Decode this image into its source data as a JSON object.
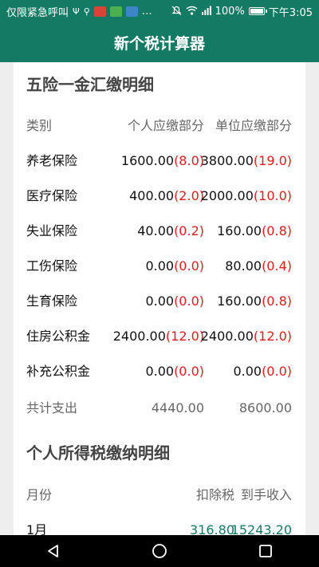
{
  "status": {
    "carrier": "仅限紧急呼叫",
    "battery": "100%",
    "battery_level": 1.0,
    "time": "下午3:05",
    "more": "…"
  },
  "app": {
    "title": "新个税计算器"
  },
  "insurance": {
    "title": "五险一金汇缴明细",
    "headers": [
      "类别",
      "个人应缴部分",
      "单位应缴部分"
    ],
    "rows": [
      {
        "name": "养老保险",
        "personal": "1600.00",
        "personal_rate": "(8.0)",
        "company": "3800.00",
        "company_rate": "(19.0)"
      },
      {
        "name": "医疗保险",
        "personal": "400.00",
        "personal_rate": "(2.0)",
        "company": "2000.00",
        "company_rate": "(10.0)"
      },
      {
        "name": "失业保险",
        "personal": "40.00",
        "personal_rate": "(0.2)",
        "company": "160.00",
        "company_rate": "(0.8)"
      },
      {
        "name": "工伤保险",
        "personal": "0.00",
        "personal_rate": "(0.0)",
        "company": "80.00",
        "company_rate": "(0.4)"
      },
      {
        "name": "生育保险",
        "personal": "0.00",
        "personal_rate": "(0.0)",
        "company": "160.00",
        "company_rate": "(0.8)"
      },
      {
        "name": "住房公积金",
        "personal": "2400.00",
        "personal_rate": "(12.0)",
        "company": "2400.00",
        "company_rate": "(12.0)"
      },
      {
        "name": "补充公积金",
        "personal": "0.00",
        "personal_rate": "(0.0)",
        "company": "0.00",
        "company_rate": "(0.0)"
      }
    ],
    "total": {
      "label": "共计支出",
      "personal": "4440.00",
      "company": "8600.00"
    }
  },
  "tax": {
    "title": "个人所得税缴纳明细",
    "headers": [
      "月份",
      "扣除税",
      "到手收入"
    ],
    "rows": [
      {
        "month": "1月",
        "tax": "316.80",
        "income": "15243.20"
      }
    ]
  },
  "colors": {
    "primary": "#137a64",
    "rate_red": "#e31c1c",
    "background": "#eeeeee"
  }
}
